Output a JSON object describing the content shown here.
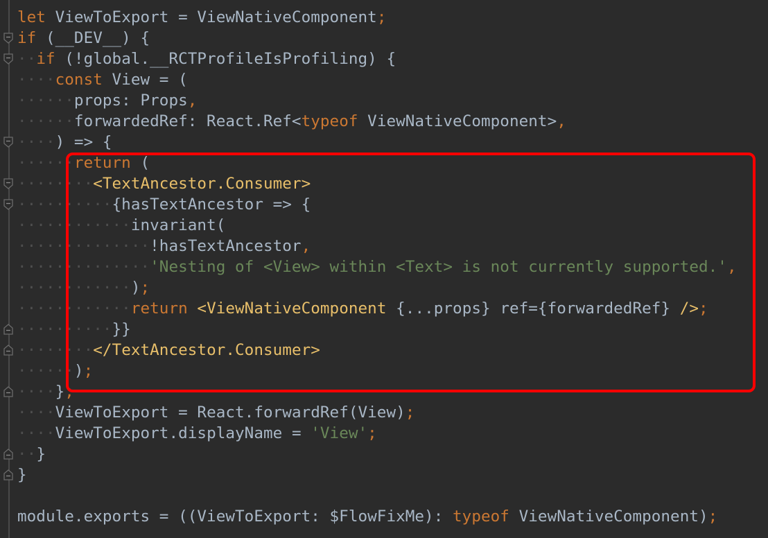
{
  "editor": {
    "highlight_color": "#ff0000",
    "lines": [
      {
        "indent": 0,
        "tokens": [
          [
            "kw",
            "let"
          ],
          [
            "id",
            " ViewToExport = ViewNativeComponent"
          ],
          [
            "punc",
            ";"
          ]
        ]
      },
      {
        "indent": 0,
        "fold": "start",
        "tokens": [
          [
            "kw",
            "if"
          ],
          [
            "id",
            " (__DEV__) {"
          ]
        ]
      },
      {
        "indent": 2,
        "fold": "start",
        "tokens": [
          [
            "kw",
            "if"
          ],
          [
            "id",
            " (!global.__RCTProfileIsProfiling) {"
          ]
        ]
      },
      {
        "indent": 4,
        "tokens": [
          [
            "kw",
            "const"
          ],
          [
            "id",
            " View = ("
          ]
        ]
      },
      {
        "indent": 6,
        "tokens": [
          [
            "id",
            "props: Props"
          ],
          [
            "punc",
            ","
          ]
        ]
      },
      {
        "indent": 6,
        "tokens": [
          [
            "id",
            "forwardedRef: React.Ref<"
          ],
          [
            "kw",
            "typeof"
          ],
          [
            "id",
            " ViewNativeComponent>"
          ],
          [
            "punc",
            ","
          ]
        ]
      },
      {
        "indent": 4,
        "fold": "start",
        "tokens": [
          [
            "id",
            ") => {"
          ]
        ]
      },
      {
        "indent": 6,
        "tokens": [
          [
            "kw",
            "return"
          ],
          [
            "id",
            " ("
          ]
        ]
      },
      {
        "indent": 8,
        "fold": "start",
        "tokens": [
          [
            "tag",
            "<TextAncestor.Consumer>"
          ]
        ]
      },
      {
        "indent": 10,
        "fold": "start",
        "tokens": [
          [
            "id",
            "{hasTextAncestor => {"
          ]
        ]
      },
      {
        "indent": 12,
        "tokens": [
          [
            "id",
            "invariant("
          ]
        ]
      },
      {
        "indent": 14,
        "tokens": [
          [
            "id",
            "!hasTextAncestor"
          ],
          [
            "punc",
            ","
          ]
        ]
      },
      {
        "indent": 14,
        "tokens": [
          [
            "str",
            "'Nesting of <View> within <Text> is not currently supported.'"
          ],
          [
            "punc",
            ","
          ]
        ]
      },
      {
        "indent": 12,
        "tokens": [
          [
            "id",
            ")"
          ],
          [
            "punc",
            ";"
          ]
        ]
      },
      {
        "indent": 12,
        "tokens": [
          [
            "kw",
            "return"
          ],
          [
            "id",
            " "
          ],
          [
            "tag",
            "<ViewNativeComponent"
          ],
          [
            "id",
            " {...props} ref={forwardedRef} "
          ],
          [
            "tag",
            "/>"
          ],
          [
            "punc",
            ";"
          ]
        ]
      },
      {
        "indent": 10,
        "fold": "end",
        "tokens": [
          [
            "id",
            "}}"
          ]
        ]
      },
      {
        "indent": 8,
        "fold": "end",
        "tokens": [
          [
            "tag",
            "</TextAncestor.Consumer>"
          ]
        ]
      },
      {
        "indent": 6,
        "tokens": [
          [
            "id",
            ")"
          ],
          [
            "punc",
            ";"
          ]
        ]
      },
      {
        "indent": 4,
        "fold": "end",
        "tokens": [
          [
            "id",
            "}"
          ],
          [
            "punc",
            ";"
          ]
        ]
      },
      {
        "indent": 4,
        "tokens": [
          [
            "id",
            "ViewToExport = React.forwardRef(View)"
          ],
          [
            "punc",
            ";"
          ]
        ]
      },
      {
        "indent": 4,
        "tokens": [
          [
            "id",
            "ViewToExport.displayName = "
          ],
          [
            "str",
            "'View'"
          ],
          [
            "punc",
            ";"
          ]
        ]
      },
      {
        "indent": 2,
        "fold": "end",
        "tokens": [
          [
            "id",
            "}"
          ]
        ]
      },
      {
        "indent": 0,
        "fold": "end",
        "tokens": [
          [
            "id",
            "}"
          ]
        ]
      },
      {
        "indent": 0,
        "tokens": []
      },
      {
        "indent": 0,
        "tokens": [
          [
            "id",
            "module.exports = ((ViewToExport: $FlowFixMe): "
          ],
          [
            "kw",
            "typeof"
          ],
          [
            "id",
            " ViewNativeComponent)"
          ],
          [
            "punc",
            ";"
          ]
        ]
      }
    ]
  }
}
